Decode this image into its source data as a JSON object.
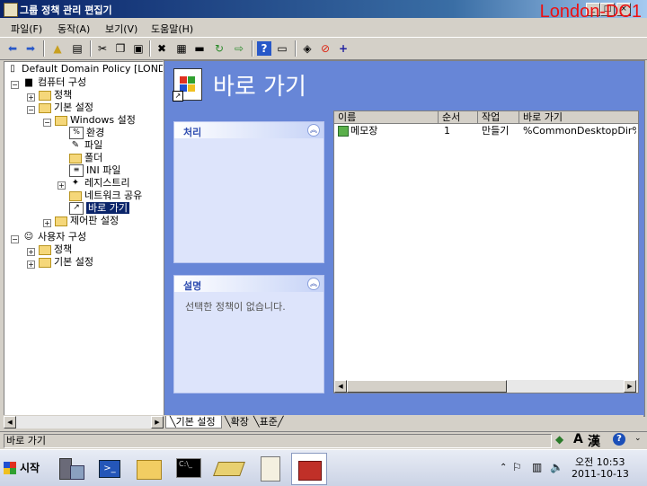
{
  "window": {
    "title": "그룹 정책 관리 편집기",
    "watermark": "London-DC1"
  },
  "menu": [
    "파일(F)",
    "동작(A)",
    "보기(V)",
    "도움말(H)"
  ],
  "tree": [
    {
      "label": "Default Domain Policy [LOND"
    },
    {
      "label": "컴퓨터 구성"
    },
    {
      "label": "정책"
    },
    {
      "label": "기본 설정"
    },
    {
      "label": "Windows 설정"
    },
    {
      "label": "환경"
    },
    {
      "label": "파일"
    },
    {
      "label": "폴더"
    },
    {
      "label": "INI 파일"
    },
    {
      "label": "레지스트리"
    },
    {
      "label": "네트워크 공유"
    },
    {
      "label": "바로 가기"
    },
    {
      "label": "제어판 설정"
    },
    {
      "label": "사용자 구성"
    },
    {
      "label": "정책"
    },
    {
      "label": "기본 설정"
    }
  ],
  "main": {
    "title": "바로 가기",
    "panel_process": "처리",
    "panel_desc": "설명",
    "desc_text": "선택한 정책이 없습니다.",
    "columns": [
      "이름",
      "순서",
      "작업",
      "바로 가기"
    ],
    "rows": [
      {
        "name": "메모장",
        "order": "1",
        "action": "만들기",
        "target": "%CommonDesktopDir%\\"
      }
    ]
  },
  "tabs": [
    "기본 설정",
    "확장",
    "표준"
  ],
  "status": "바로 가기",
  "taskbar": {
    "start": "시작",
    "ime_a": "A",
    "ime_han": "漢",
    "time": "오전 10:53",
    "date": "2011-10-13"
  },
  "colors": {
    "title_bar": "#0a246a",
    "pane_bg": "#6786d7",
    "selected": "#0a246a",
    "watermark": "#e11111"
  }
}
